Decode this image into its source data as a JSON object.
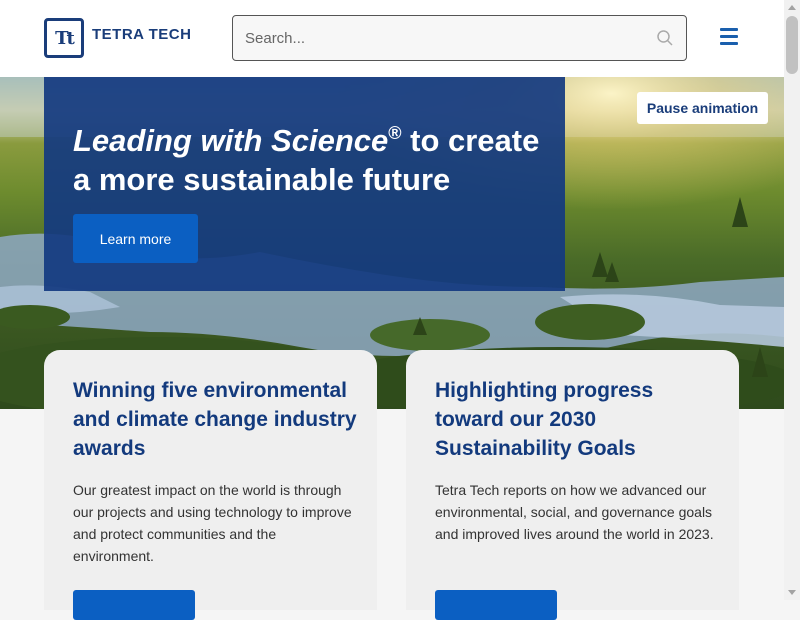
{
  "header": {
    "logo_mark": "Tt",
    "logo_text": "TETRA TECH",
    "search_placeholder": "Search..."
  },
  "hero": {
    "title_italic": "Leading with Science",
    "title_reg": "®",
    "title_rest": " to create a more sustainable future",
    "learn_more": "Learn more",
    "pause": "Pause animation"
  },
  "cards": [
    {
      "title": "Winning five environmental and climate change industry awards",
      "body": "Our greatest impact on the world is through our projects and using technology to improve and protect communities and the environment."
    },
    {
      "title": "Highlighting progress toward our 2030 Sustainability Goals",
      "body": "Tetra Tech reports on how we advanced our environmental, social, and governance goals and improved lives around the world in 2023."
    }
  ],
  "colors": {
    "brand_navy": "#133a7d",
    "button_blue": "#0b5fc2",
    "menu_blue": "#1a5fad"
  }
}
